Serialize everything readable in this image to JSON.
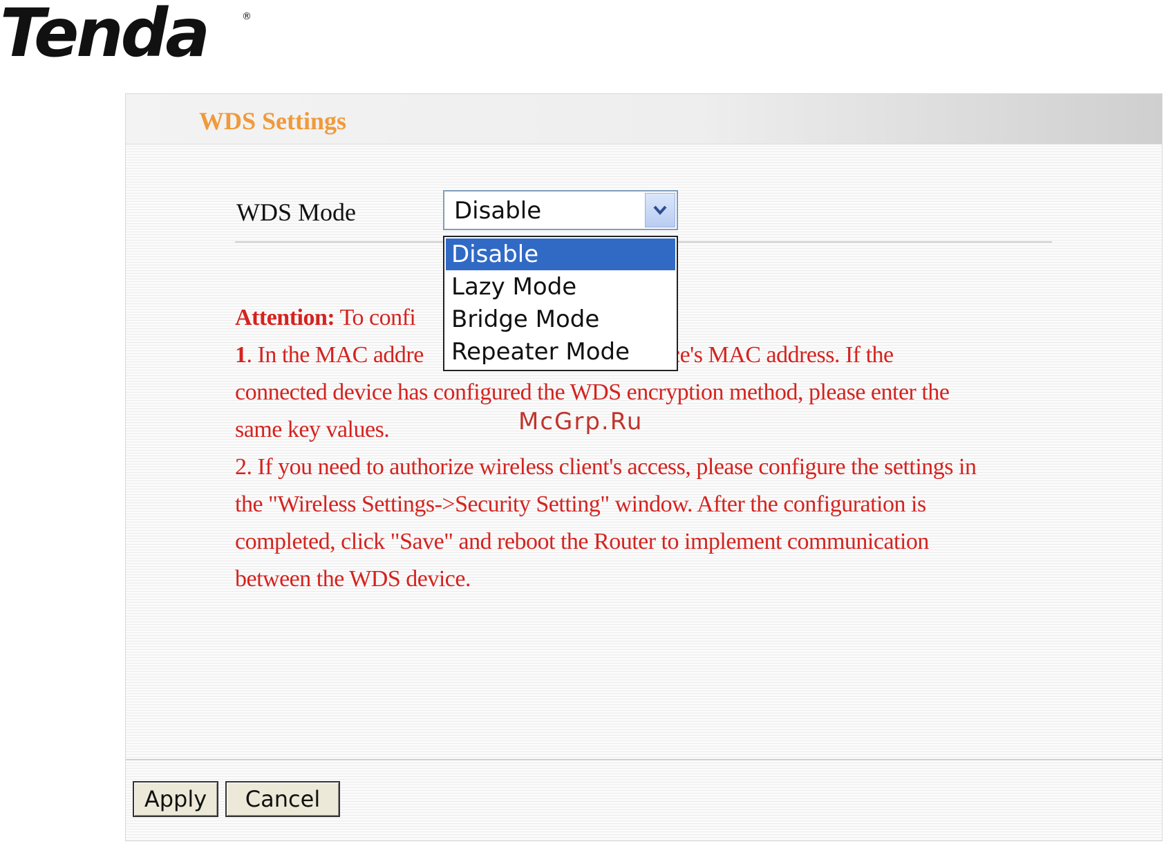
{
  "brand": {
    "logo_text": "Tenda",
    "registered_mark": "®"
  },
  "header": {
    "title": "WDS Settings"
  },
  "wds_mode": {
    "label": "WDS Mode",
    "selected": "Disable",
    "options": [
      "Disable",
      "Lazy Mode",
      "Bridge Mode",
      "Repeater Mode"
    ],
    "highlighted_option": "Disable",
    "arrow_icon": "chevron-down-icon"
  },
  "attention": {
    "prefix": "Attention:",
    "lead": " To confi",
    "item1_num": "1",
    "item1_visible_start": ". In the MAC addre",
    "item1_visible_end": "cted device's MAC address. If the",
    "item1_line2": "connected device has configured the WDS encryption method, please enter the",
    "item1_line3": "same key values.",
    "item2_line1": "2. If you need to authorize wireless client's access, please configure the settings in",
    "item2_line2": "the \"Wireless Settings->Security Setting\" window. After the configuration is",
    "item2_line3": "completed, click \"Save\" and reboot the Router to implement communication",
    "item2_line4": "between the WDS device."
  },
  "watermark": "McGrp.Ru",
  "buttons": {
    "apply": "Apply",
    "cancel": "Cancel"
  },
  "colors": {
    "title": "#ef9a3c",
    "note_text": "#d4231f",
    "selection": "#316ac5"
  }
}
